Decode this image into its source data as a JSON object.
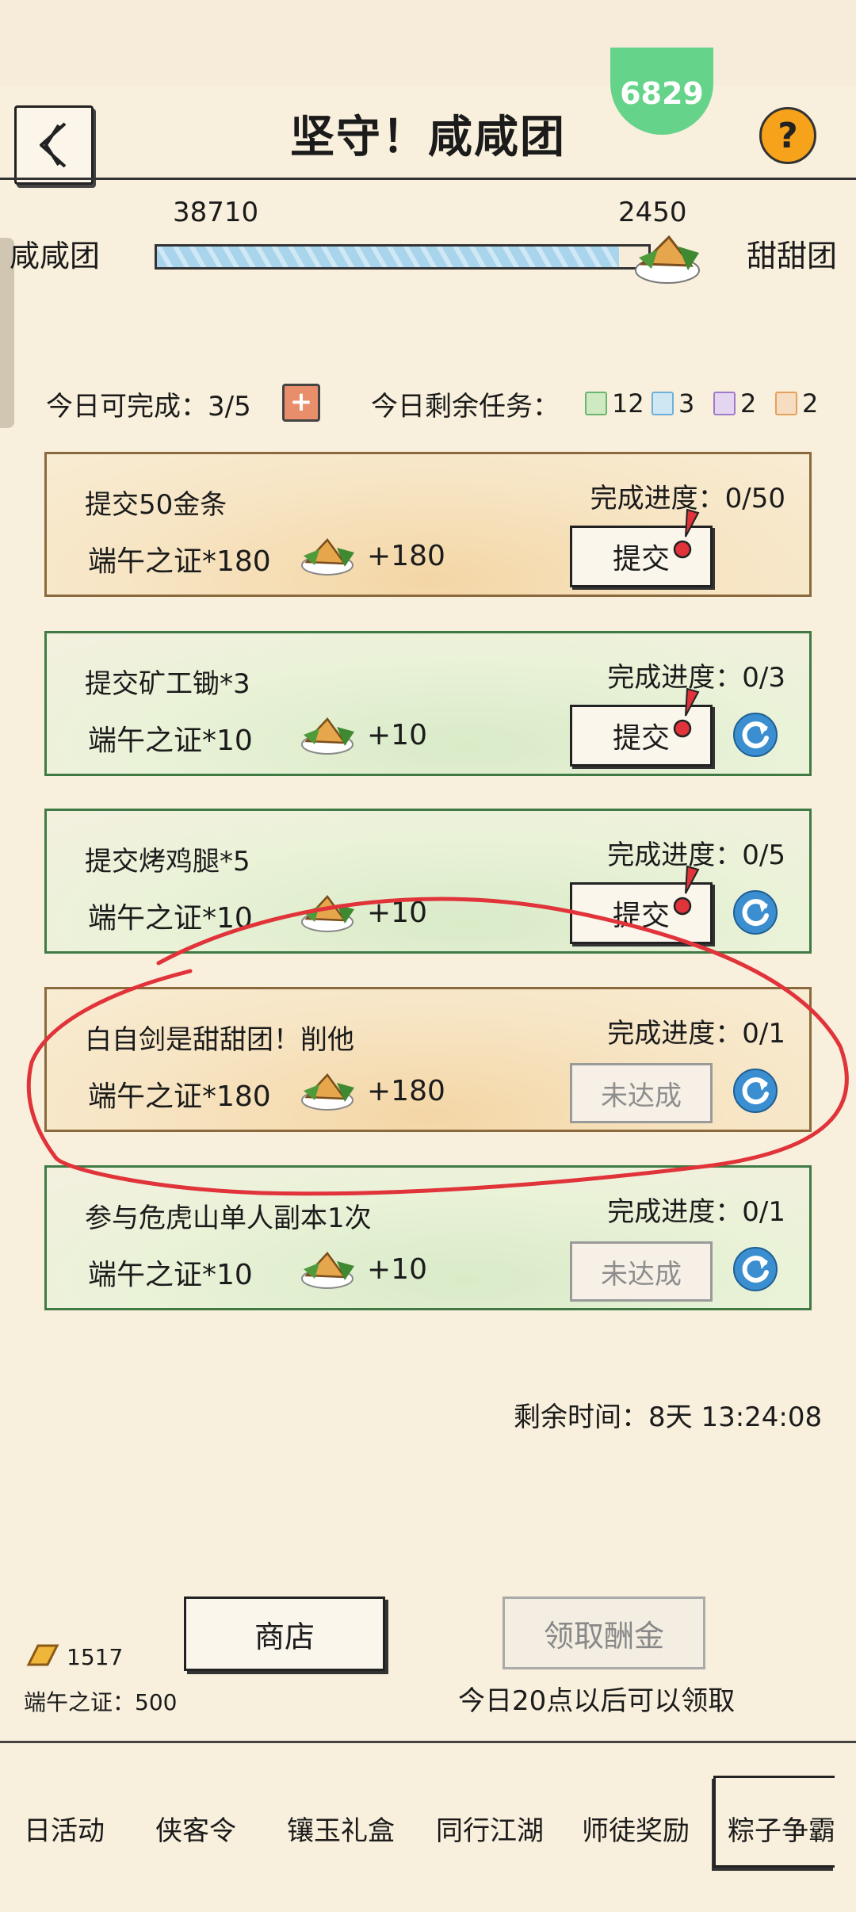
{
  "header": {
    "title": "坚守！咸咸团",
    "badge_value": "6829",
    "help_label": "?"
  },
  "tug": {
    "left_team": "咸咸团",
    "right_team": "甜甜团",
    "left_score": "38710",
    "right_score": "2450",
    "left_share": 0.94
  },
  "daily": {
    "label": "今日可完成：3/5",
    "plus_label": "+",
    "remaining_label": "今日剩余任务：",
    "chips": [
      {
        "count": "12",
        "color": "#6cb56d"
      },
      {
        "count": "3",
        "color": "#6fb0d8"
      },
      {
        "count": "2",
        "color": "#a07cc8"
      },
      {
        "count": "2",
        "color": "#e4a05c"
      }
    ]
  },
  "tasks": [
    {
      "name": "提交50金条",
      "reward": "端午之证*180",
      "plus": "+180",
      "progress": "完成进度：0/50",
      "button": "提交",
      "state": "submit",
      "theme": "orange",
      "refresh": false
    },
    {
      "name": "提交矿工锄*3",
      "reward": "端午之证*10",
      "plus": "+10",
      "progress": "完成进度：0/3",
      "button": "提交",
      "state": "submit",
      "theme": "green",
      "refresh": true
    },
    {
      "name": "提交烤鸡腿*5",
      "reward": "端午之证*10",
      "plus": "+10",
      "progress": "完成进度：0/5",
      "button": "提交",
      "state": "submit",
      "theme": "green",
      "refresh": true
    },
    {
      "name": "白自剑是甜甜团！削他",
      "reward": "端午之证*180",
      "plus": "+180",
      "progress": "完成进度：0/1",
      "button": "未达成",
      "state": "disabled",
      "theme": "orange",
      "refresh": true
    },
    {
      "name": "参与危虎山单人副本1次",
      "reward": "端午之证*10",
      "plus": "+10",
      "progress": "完成进度：0/1",
      "button": "未达成",
      "state": "disabled",
      "theme": "green",
      "refresh": true
    }
  ],
  "bottom": {
    "time_left": "剩余时间：8天 13:24:08",
    "shop_label": "商店",
    "claim_label": "领取酬金",
    "claim_note": "今日20点以后可以领取",
    "gold_count": "1517",
    "cert_count": "端午之证：500"
  },
  "tabs": [
    {
      "label": "日活动"
    },
    {
      "label": "侠客令"
    },
    {
      "label": "镶玉礼盒"
    },
    {
      "label": "同行江湖"
    },
    {
      "label": "师徒奖励"
    },
    {
      "label": "粽子争霸"
    }
  ],
  "colors": {
    "background": "#f8efdc",
    "annotation_red": "#e0333a",
    "accent_orange": "#f6a21a",
    "badge_green": "#66d38a",
    "refresh_blue": "#3b8fd0"
  }
}
